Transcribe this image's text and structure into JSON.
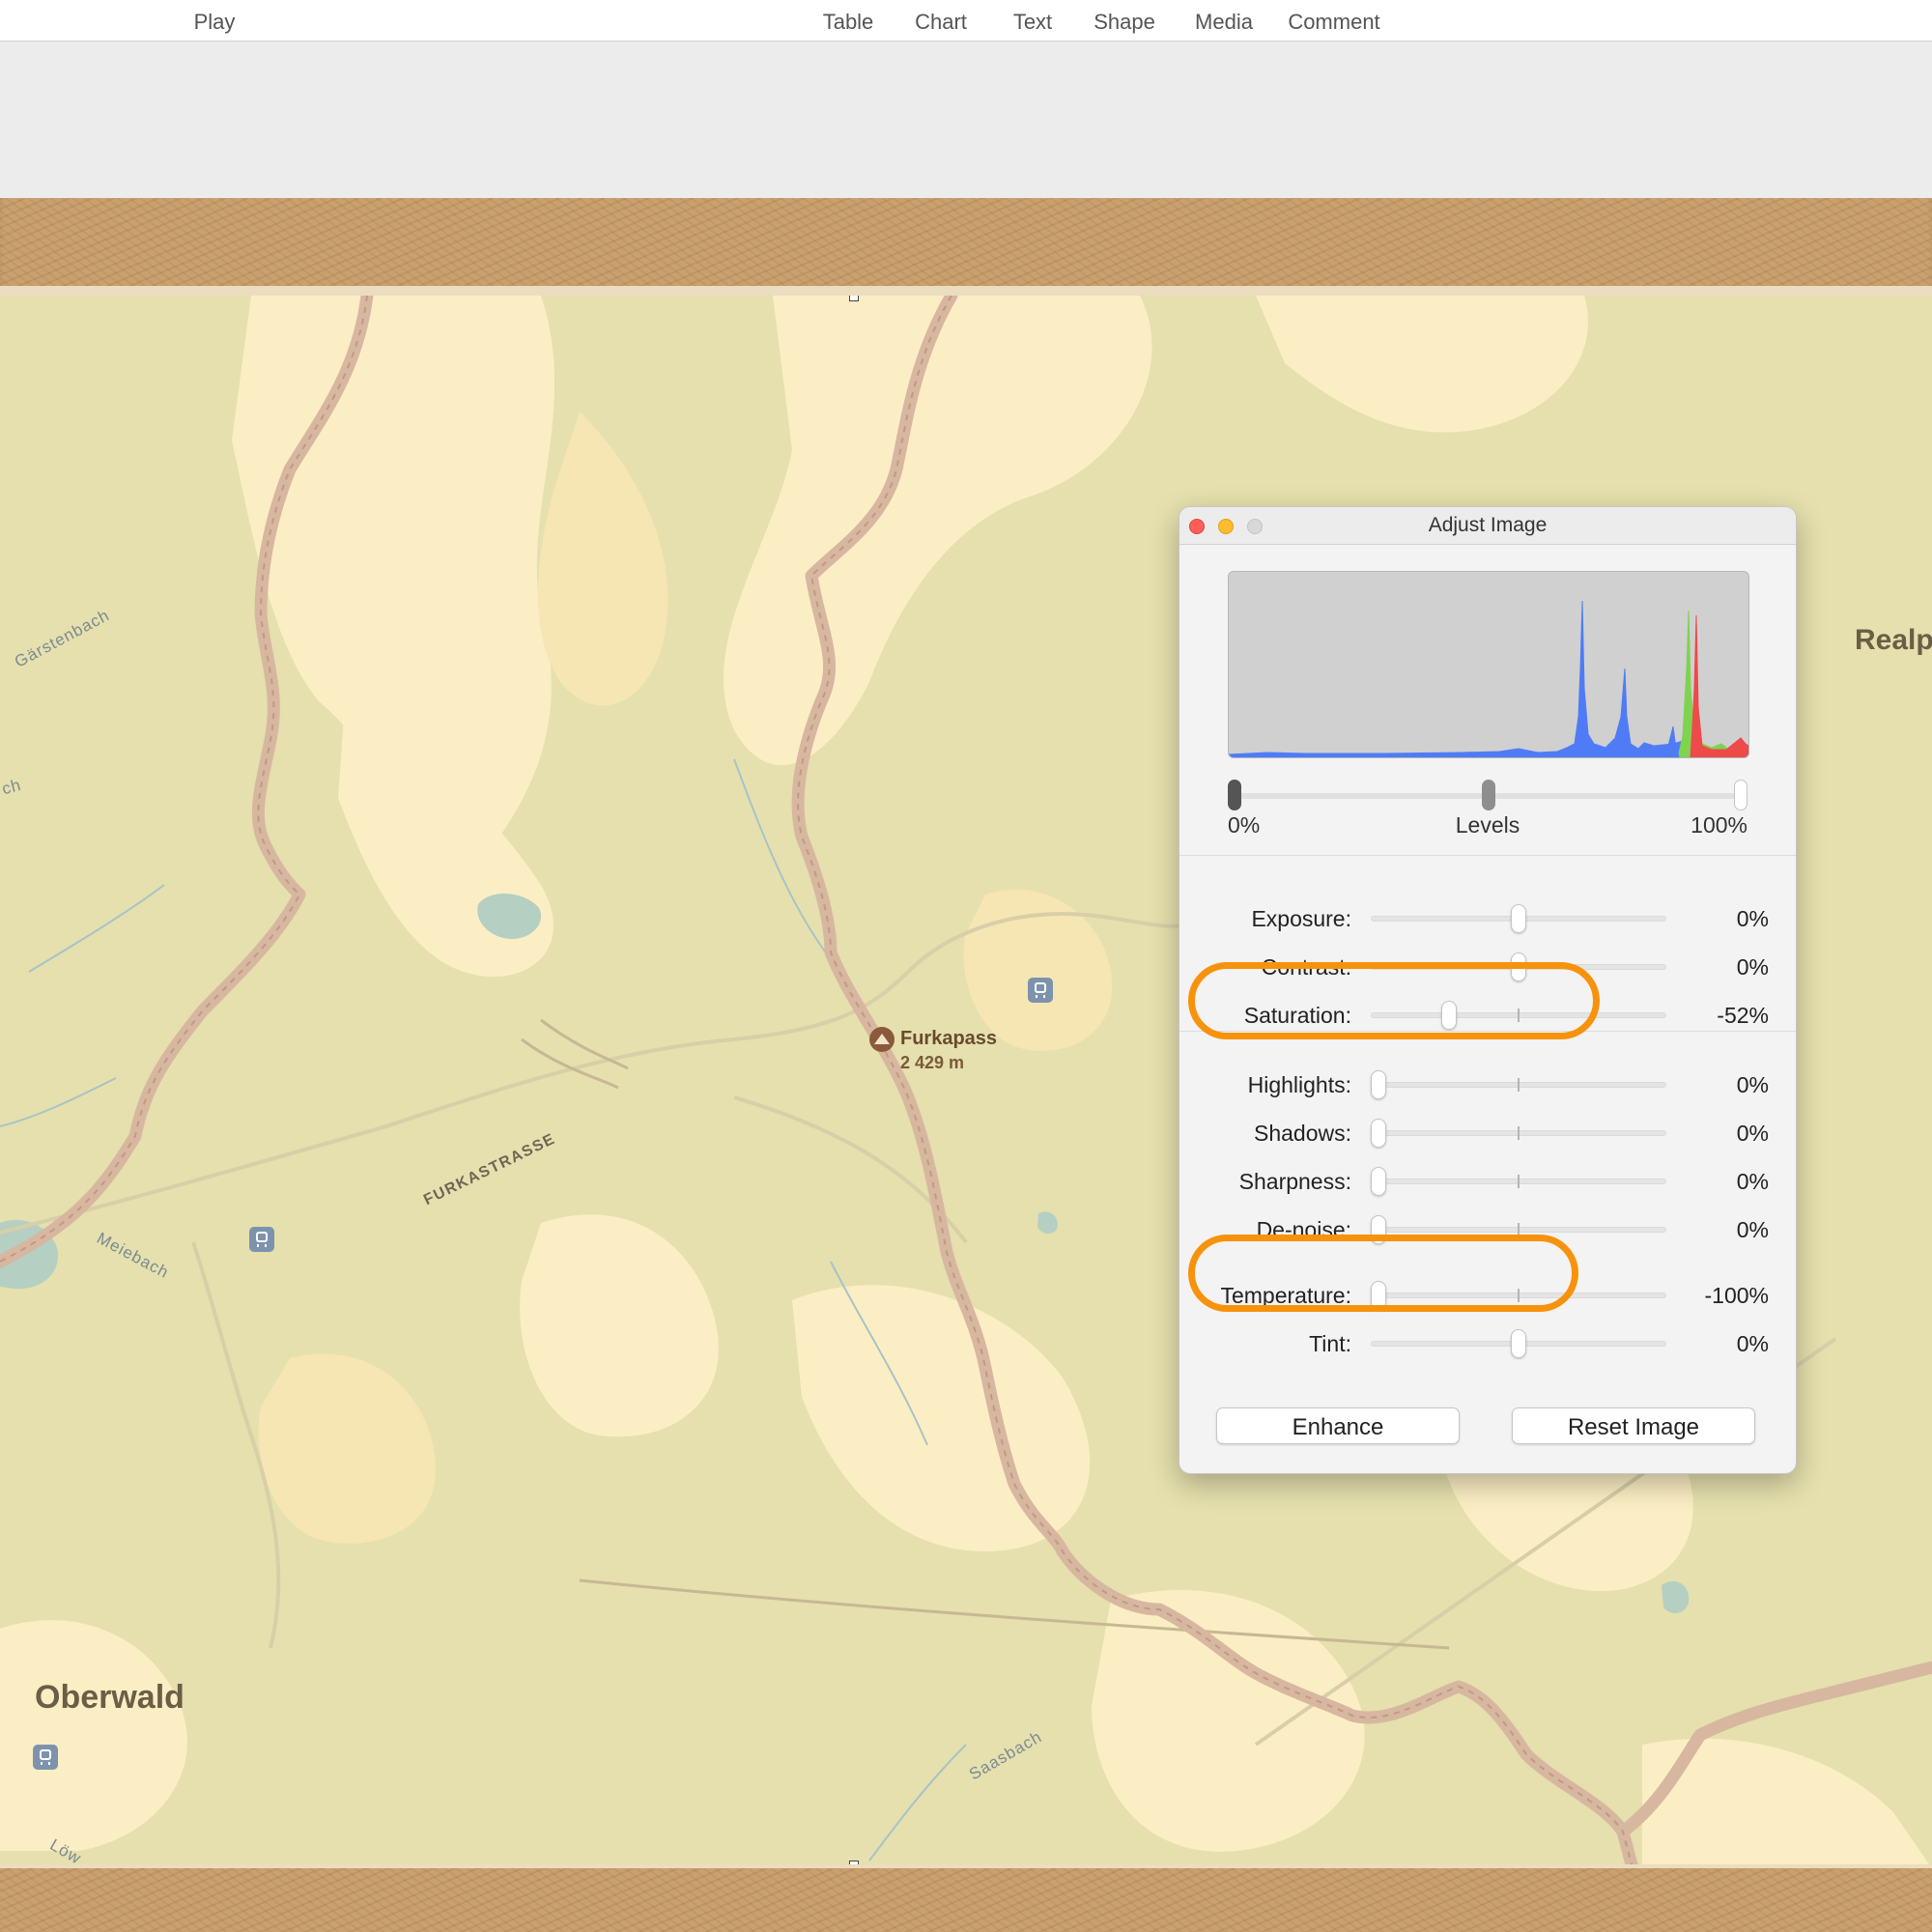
{
  "toolbar": {
    "play": "Play",
    "table": "Table",
    "chart": "Chart",
    "text": "Text",
    "shape": "Shape",
    "media": "Media",
    "comment": "Comment"
  },
  "map": {
    "places": {
      "oberwald": "Oberwald",
      "realp": "Realp",
      "furkapass": "Furkapass",
      "furkapass_elevation": "2 429 m"
    },
    "rivers": {
      "garstenbach": "Gärstenbach",
      "meiebach": "Meiebach",
      "saasbach": "Saasbach",
      "ch_fragment": "ch",
      "low_fragment": "Löw"
    },
    "roads": {
      "furkastrasse": "FURKASTRASSE"
    },
    "icons": {
      "rail": "train-station-icon",
      "pass": "mountain-pass-icon"
    }
  },
  "panel": {
    "title": "Adjust Image",
    "levels": {
      "min_label": "0%",
      "center_label": "Levels",
      "max_label": "100%",
      "black_point": 0,
      "midpoint": 0.5,
      "white_point": 1
    },
    "sliders": [
      {
        "label": "Exposure:",
        "value": "0%",
        "position": 0.5
      },
      {
        "label": "Contrast:",
        "value": "0%",
        "position": 0.5
      },
      {
        "label": "Saturation:",
        "value": "-52%",
        "position": 0.25
      },
      {
        "label": "Highlights:",
        "value": "0%",
        "position": 0.0
      },
      {
        "label": "Shadows:",
        "value": "0%",
        "position": 0.0
      },
      {
        "label": "Sharpness:",
        "value": "0%",
        "position": 0.0
      },
      {
        "label": "De-noise:",
        "value": "0%",
        "position": 0.0
      },
      {
        "label": "Temperature:",
        "value": "-100%",
        "position": 0.0
      },
      {
        "label": "Tint:",
        "value": "0%",
        "position": 0.5
      }
    ],
    "buttons": {
      "enhance": "Enhance",
      "reset": "Reset Image"
    }
  },
  "colors": {
    "accent_highlight": "#f7920c",
    "histogram_blue": "#4f7cf6",
    "histogram_green": "#7fd34f",
    "histogram_red": "#ee4a4a"
  }
}
